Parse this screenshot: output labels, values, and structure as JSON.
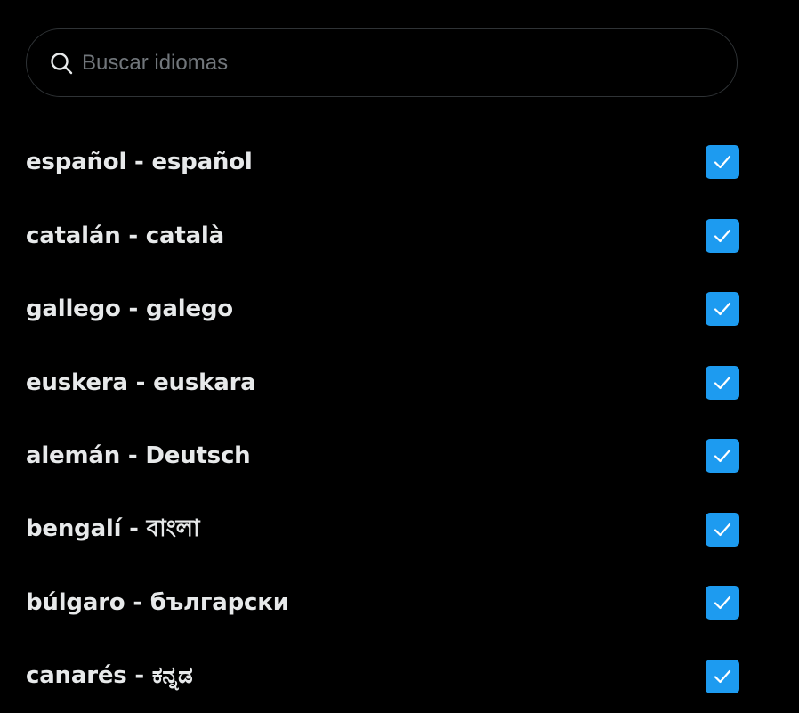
{
  "search": {
    "placeholder": "Buscar idiomas",
    "value": ""
  },
  "icons": {
    "search": "search-icon",
    "check": "checkmark-icon"
  },
  "colors": {
    "background": "#000000",
    "text": "#e7e9ea",
    "placeholder": "#71767b",
    "border": "#2f3336",
    "checkbox": "#1d9bf0",
    "checkmark": "#ffffff"
  },
  "languages": [
    {
      "label": "español - español",
      "checked": true
    },
    {
      "label": "catalán - català",
      "checked": true
    },
    {
      "label": "gallego - galego",
      "checked": true
    },
    {
      "label": "euskera - euskara",
      "checked": true
    },
    {
      "label": "alemán - Deutsch",
      "checked": true
    },
    {
      "label": "bengalí - বাংলা",
      "checked": true
    },
    {
      "label": "búlgaro - български",
      "checked": true
    },
    {
      "label": "canarés - ಕನ್ನಡ",
      "checked": true
    }
  ]
}
